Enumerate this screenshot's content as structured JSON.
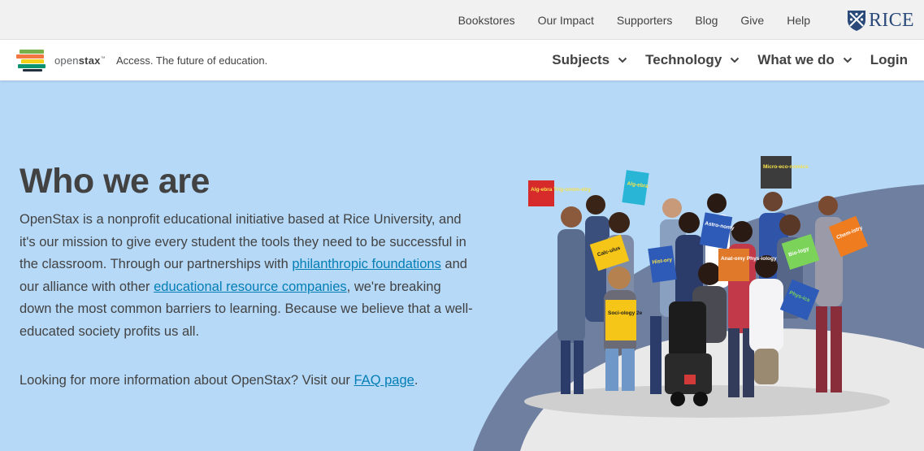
{
  "utility": {
    "links": [
      "Bookstores",
      "Our Impact",
      "Supporters",
      "Blog",
      "Give",
      "Help"
    ],
    "partner_logo": "RICE"
  },
  "nav": {
    "logo_light": "open",
    "logo_bold": "stax",
    "logo_tm": "™",
    "tagline": "Access. The future of education.",
    "items": [
      "Subjects",
      "Technology",
      "What we do"
    ],
    "login": "Login"
  },
  "hero": {
    "title": "Who we are",
    "body_1": "OpenStax is a nonprofit educational initiative based at Rice University, and it's our mission to give every student the tools they need to be successful in the classroom. Through our partnerships with ",
    "link_1": "philanthropic foundations",
    "body_2": " and our alliance with other ",
    "link_2": "educational resource companies",
    "body_3": ", we're breaking down the most common barriers to learning. Because we believe that a well-educated society profits us all.",
    "faq_text": "Looking for more information about OpenStax? Visit our ",
    "faq_link": "FAQ page",
    "faq_end": "."
  },
  "photo": {
    "books": [
      {
        "label": "Alg-ebra Trig-onom-etry",
        "color": "#d72a2a"
      },
      {
        "label": "Alg-ebra",
        "color": "#29b6d6"
      },
      {
        "label": "Micro-eco-nomics",
        "color": "#3c3c3c"
      },
      {
        "label": "Astro-nomy",
        "color": "#2e5bb8"
      },
      {
        "label": "Calc-ulus",
        "color": "#f5c518"
      },
      {
        "label": "Hist-ory",
        "color": "#2e5bb8"
      },
      {
        "label": "Anat-omy Phys-iology",
        "color": "#e07a2a"
      },
      {
        "label": "Chem-istry",
        "color": "#f07c20"
      },
      {
        "label": "Soci-ology 2e",
        "color": "#f5c518"
      },
      {
        "label": "Phys-ics",
        "color": "#2e5bb8"
      },
      {
        "label": "Bio-logy",
        "color": "#7bd35a"
      }
    ]
  },
  "colors": {
    "hero_bg": "#b6d9f8",
    "link": "#027eb5",
    "text": "#424242",
    "utility_bg": "#f1f1f1",
    "rice_blue": "#2b4a7a"
  }
}
